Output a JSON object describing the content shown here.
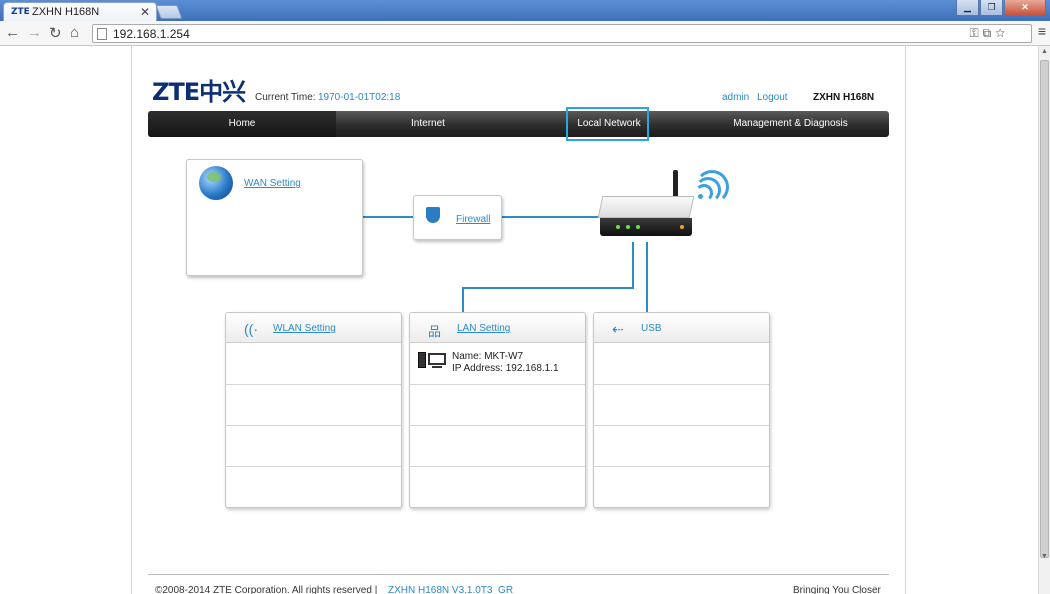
{
  "browser": {
    "tab_logo": "ZTE",
    "tab_title": "ZXHN H168N",
    "tab_close": "✕",
    "url": "192.168.1.254",
    "back": "←",
    "forward": "→",
    "reload": "↻",
    "home": "⌂",
    "omnibox_icons": "⚿⧉☆",
    "menu": "≡",
    "min": "▁",
    "max": "❐",
    "close": "✕"
  },
  "header": {
    "logo": "ZTE中兴",
    "current_time_label": "Current Time:",
    "current_time_value": "1970-01-01T02:18",
    "user": "admin",
    "logout": "Logout",
    "model": "ZXHN H168N"
  },
  "nav": {
    "items": [
      "Home",
      "Internet",
      "Local Network",
      "Management & Diagnosis"
    ]
  },
  "diagram": {
    "wan_setting": "WAN Setting",
    "firewall": "Firewall",
    "wlan_setting": "WLAN Setting",
    "lan_setting": "LAN Setting",
    "usb": "USB",
    "device": {
      "name": "Name: MKT-W7",
      "ip": "IP Address: 192.168.1.1"
    }
  },
  "footer": {
    "copyright": "©2008-2014 ZTE Corporation. All rights reserved  |",
    "firmware": "ZXHN H168N V3.1.0T3_GR",
    "slogan": "Bringing You Closer"
  },
  "colors": {
    "accent": "#2b8ac9",
    "nav_dark": "#1d1d1d",
    "highlight": "#2aa7dc"
  }
}
